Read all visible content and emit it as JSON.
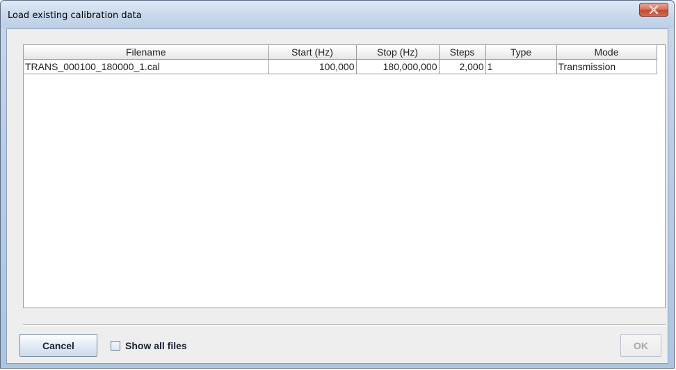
{
  "window": {
    "title": "Load existing calibration data",
    "close_icon": "close-icon",
    "colors": {
      "close_button": "#c44a32",
      "title_bar": "#c8d8eb",
      "client_bg": "#eeeeee"
    }
  },
  "table": {
    "columns": [
      "Filename",
      "Start (Hz)",
      "Stop (Hz)",
      "Steps",
      "Type",
      "Mode"
    ],
    "rows": [
      {
        "filename": "TRANS_000100_180000_1.cal",
        "start": "100,000",
        "stop": "180,000,000",
        "steps": "2,000",
        "type": "1",
        "mode": "Transmission"
      }
    ]
  },
  "footer": {
    "cancel_label": "Cancel",
    "show_all_label": "Show all files",
    "show_all_checked": false,
    "ok_label": "OK",
    "ok_enabled": false
  }
}
